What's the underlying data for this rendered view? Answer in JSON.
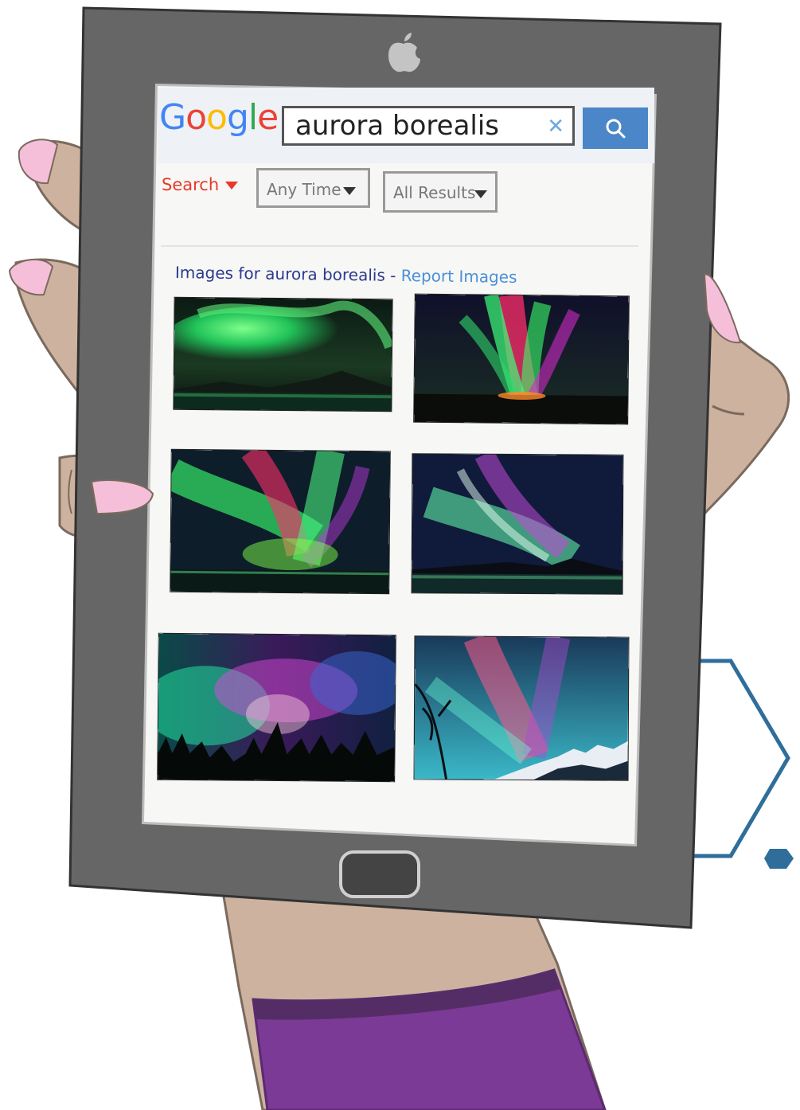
{
  "illustration": {
    "tablet_logo_icon": "apple-icon",
    "home_button_icon": "home-button"
  },
  "search": {
    "logo_letters": [
      {
        "char": "G",
        "color": "#4285F4"
      },
      {
        "char": "o",
        "color": "#EA4335"
      },
      {
        "char": "o",
        "color": "#FBBC05"
      },
      {
        "char": "g",
        "color": "#4285F4"
      },
      {
        "char": "l",
        "color": "#34A853"
      },
      {
        "char": "e",
        "color": "#EA4335"
      }
    ],
    "query": "aurora borealis",
    "clear_icon": "close-icon",
    "submit_icon": "search-icon"
  },
  "filters": {
    "search_label": "Search",
    "time_label": "Any Time",
    "results_label": "All Results"
  },
  "images_section": {
    "heading_prefix": "Images for aurora borealis",
    "separator": "-",
    "report_link": "Report Images"
  },
  "colors": {
    "accent_blue": "#4a86c8",
    "filter_red": "#e8392b",
    "tablet_frame": "#666666",
    "sleeve_purple": "#7b3a96",
    "skin": "#cdb39f",
    "nail_pink": "#f5bfd9",
    "hex_outline": "#2f6e9b"
  }
}
